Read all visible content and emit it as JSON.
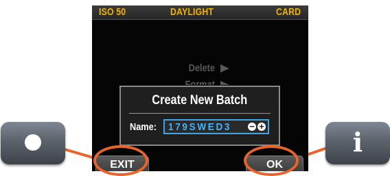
{
  "status_bar": {
    "iso": "ISO 50",
    "white_balance": "DAYLIGHT",
    "storage": "CARD"
  },
  "menu": {
    "items": [
      {
        "label": "Delete"
      },
      {
        "label": "Format"
      }
    ]
  },
  "dialog": {
    "title": "Create New Batch",
    "name_label": "Name:",
    "name_value": "179SWED3",
    "minus_symbol": "−",
    "plus_symbol": "+"
  },
  "softkeys": {
    "left": "EXIT",
    "right": "OK"
  },
  "hardware_buttons": {
    "left_icon": "dot-icon",
    "right_icon": "info-icon",
    "right_glyph": "i"
  },
  "colors": {
    "highlight": "#e8642a",
    "status_text": "#f2b300",
    "field_text": "#3fb4ff"
  }
}
